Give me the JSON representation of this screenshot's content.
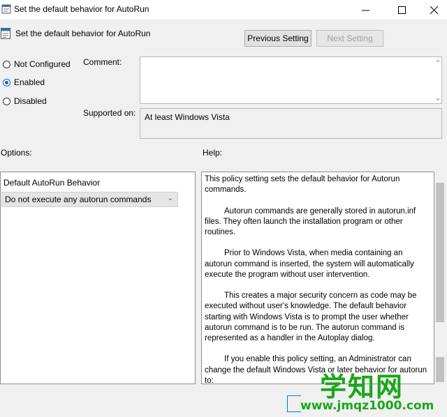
{
  "window": {
    "title": "Set the default behavior for AutoRun",
    "icons": {
      "app": "policy-document-icon",
      "minimize": "minimize-icon",
      "maximize": "maximize-icon",
      "close": "close-icon"
    }
  },
  "header": {
    "policy_name": "Set the default behavior for AutoRun",
    "previous_label": "Previous Setting",
    "next_label": "Next Setting"
  },
  "state": {
    "options": [
      "Not Configured",
      "Enabled",
      "Disabled"
    ],
    "selected": "Enabled"
  },
  "comment": {
    "label": "Comment:",
    "value": ""
  },
  "supported": {
    "label": "Supported on:",
    "value": "At least Windows Vista"
  },
  "options": {
    "label": "Options:",
    "title": "Default AutoRun Behavior",
    "selected_value": "Do not execute any autorun commands"
  },
  "help": {
    "label": "Help:",
    "paragraphs": [
      "This policy setting sets the default behavior for Autorun commands.",
      "Autorun commands are generally stored in autorun.inf files. They often launch the installation program or other routines.",
      "Prior to Windows Vista, when media containing an autorun command is inserted, the system will automatically execute the program without user intervention.",
      "This creates a major security concern as code may be executed without user's knowledge. The default behavior starting with Windows Vista is to prompt the user whether autorun command is to be run. The autorun command is represented as a handler in the Autoplay dialog.",
      "If you enable this policy setting, an Administrator can change the default Windows Vista or later behavior for autorun to:"
    ]
  },
  "watermark": {
    "text": "学知网",
    "url": "www.jmqz1000.com"
  },
  "colors": {
    "accent": "#0a64c8",
    "watermark": "#1aa61a"
  }
}
